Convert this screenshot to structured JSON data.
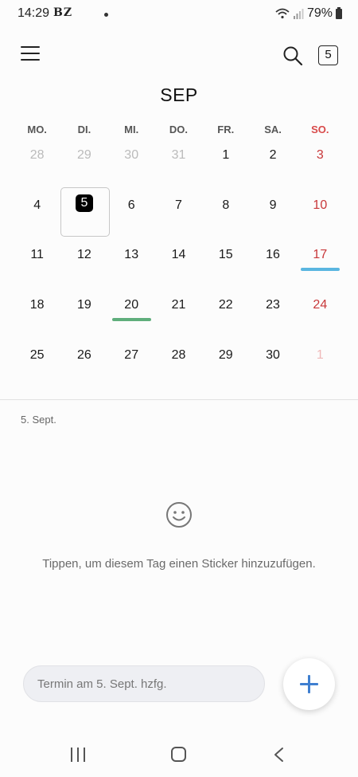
{
  "status_bar": {
    "time": "14:29",
    "apps": "BZ",
    "battery": "79%"
  },
  "header": {
    "month": "SEP",
    "today_number": "5"
  },
  "weekdays": [
    "MO.",
    "DI.",
    "MI.",
    "DO.",
    "FR.",
    "SA.",
    "SO."
  ],
  "weeks": [
    [
      "28",
      "29",
      "30",
      "31",
      "1",
      "2",
      "3"
    ],
    [
      "4",
      "5",
      "6",
      "7",
      "8",
      "9",
      "10"
    ],
    [
      "11",
      "12",
      "13",
      "14",
      "15",
      "16",
      "17"
    ],
    [
      "18",
      "19",
      "20",
      "21",
      "22",
      "23",
      "24"
    ],
    [
      "25",
      "26",
      "27",
      "28",
      "29",
      "30",
      "1"
    ]
  ],
  "event_colors": {
    "blue": "#5ab6e0",
    "green": "#5fae7c"
  },
  "selected_date_label": "5. Sept.",
  "sticker_hint": "Tippen, um diesem Tag einen Sticker hinzuzufügen.",
  "add_event_placeholder": "Termin am 5. Sept. hzfg.",
  "icons": {
    "menu": "menu-icon",
    "search": "search-icon",
    "sticker": "smiley-icon",
    "add": "plus-icon"
  }
}
